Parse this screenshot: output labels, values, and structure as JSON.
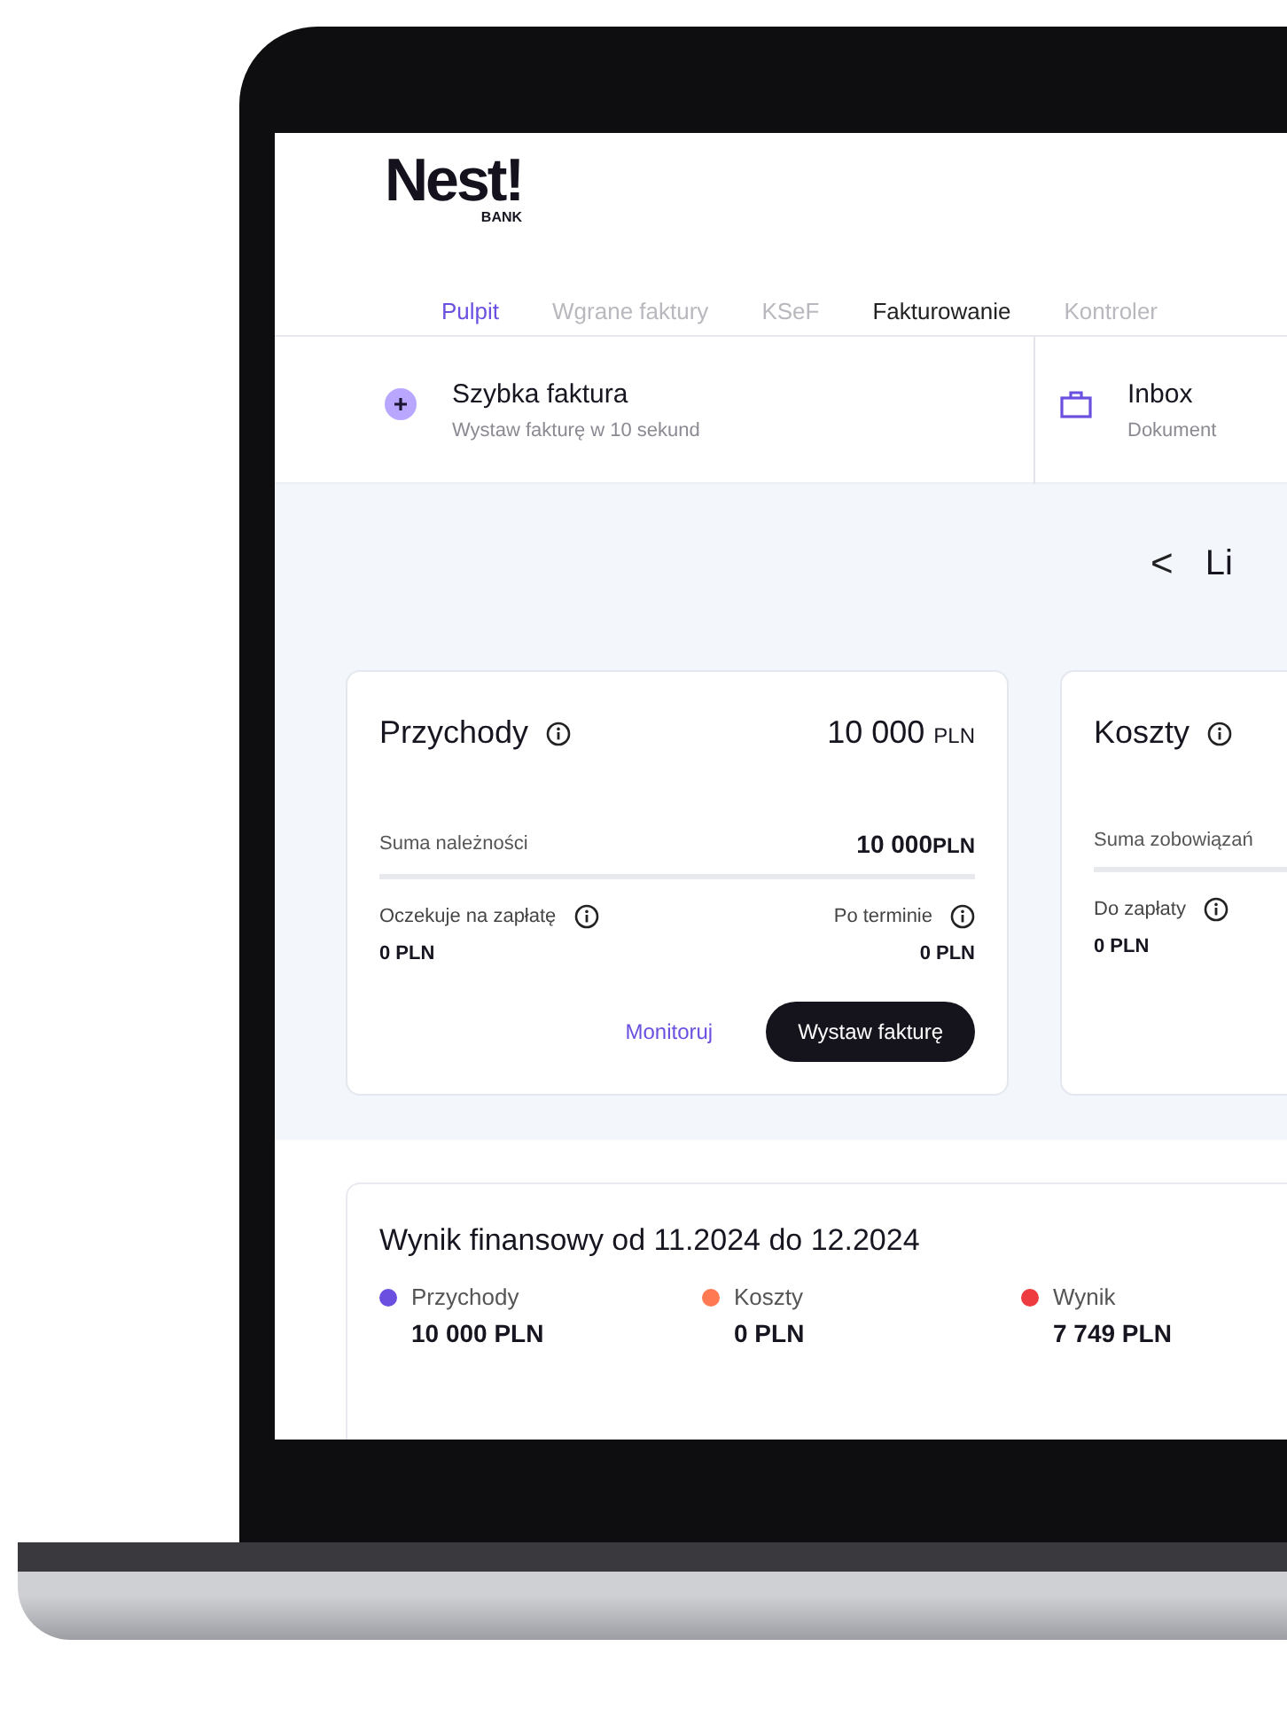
{
  "logo": {
    "name": "Nest!",
    "sub": "BANK"
  },
  "nav": [
    {
      "label": "Pulpit",
      "selected": true,
      "disabled": false
    },
    {
      "label": "Wgrane faktury",
      "selected": false,
      "disabled": true
    },
    {
      "label": "KSeF",
      "selected": false,
      "disabled": true
    },
    {
      "label": "Fakturowanie",
      "selected": false,
      "disabled": false
    },
    {
      "label": "Kontroler",
      "selected": false,
      "disabled": true
    }
  ],
  "quick_actions": [
    {
      "kind": "plus",
      "title": "Szybka faktura",
      "subtitle": "Wystaw fakturę w 10 sekund"
    },
    {
      "kind": "briefcase",
      "title": "Inbox",
      "subtitle": "Dokument"
    }
  ],
  "period": {
    "back": "<",
    "label": "Li"
  },
  "cards": [
    {
      "title": "Przychody",
      "amount": "10 000",
      "currency": "PLN",
      "sum_label": "Suma należności",
      "sum_amount": "10 000",
      "sum_currency": "PLN",
      "stats": [
        {
          "label": "Oczekuje na zapłatę",
          "value": "0 PLN"
        },
        {
          "label": "Po terminie",
          "value": "0 PLN"
        }
      ],
      "link": "Monitoruj",
      "button": "Wystaw fakturę"
    },
    {
      "title": "Koszty",
      "sum_label": "Suma zobowiązań",
      "stats": [
        {
          "label": "Do zapłaty",
          "value": "0 PLN"
        }
      ]
    }
  ],
  "result": {
    "title": "Wynik finansowy od 11.2024 do 12.2024",
    "legend": [
      {
        "label": "Przychody",
        "value": "10 000 PLN",
        "color": "#6b4fe0"
      },
      {
        "label": "Koszty",
        "value": "0 PLN",
        "color": "#ff7a52"
      },
      {
        "label": "Wynik",
        "value": "7 749 PLN",
        "color": "#ee3b3f"
      }
    ]
  }
}
